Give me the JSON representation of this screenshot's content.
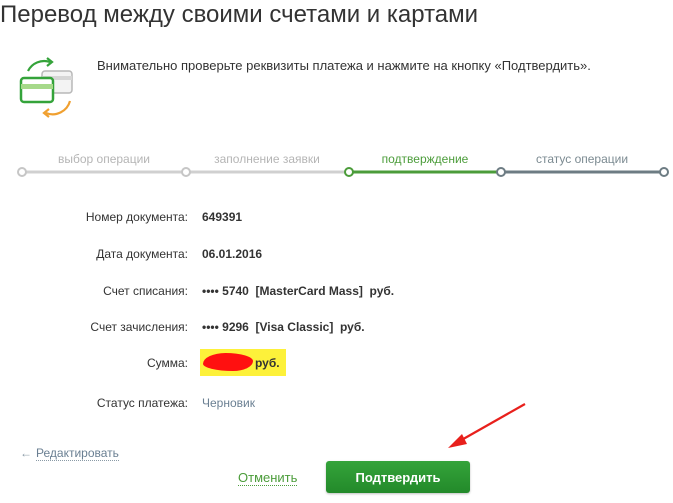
{
  "page": {
    "title": "Перевод между своими счетами и картами",
    "instruction": "Внимательно проверьте реквизиты платежа и нажмите на кнопку «Подтвердить»."
  },
  "steps": [
    {
      "label": "выбор операции",
      "state": "done"
    },
    {
      "label": "заполнение заявки",
      "state": "done"
    },
    {
      "label": "подтверждение",
      "state": "current"
    },
    {
      "label": "статус операции",
      "state": "next"
    }
  ],
  "details": {
    "doc_number": {
      "label": "Номер документа:",
      "value": "649391"
    },
    "doc_date": {
      "label": "Дата документа:",
      "value": "06.01.2016"
    },
    "from_account": {
      "label": "Счет списания:",
      "value": "•••• 5740  [MasterCard Mass]  руб."
    },
    "to_account": {
      "label": "Счет зачисления:",
      "value": "•••• 9296  [Visa Classic]  руб."
    },
    "amount": {
      "label": "Сумма:",
      "currency": "руб."
    },
    "status": {
      "label": "Статус платежа:",
      "value": "Черновик"
    }
  },
  "actions": {
    "edit": "Редактировать",
    "cancel": "Отменить",
    "confirm": "Подтвердить"
  },
  "colors": {
    "accent_green": "#4b9c3a",
    "button_green": "#2a962f",
    "progress_done": "#d0d0d0",
    "progress_next": "#6d7c83",
    "highlight": "#fdf13a",
    "annotation_red": "#e8201c"
  },
  "icons": {
    "header": "card-transfer-icon",
    "edit": "arrow-left-icon"
  }
}
